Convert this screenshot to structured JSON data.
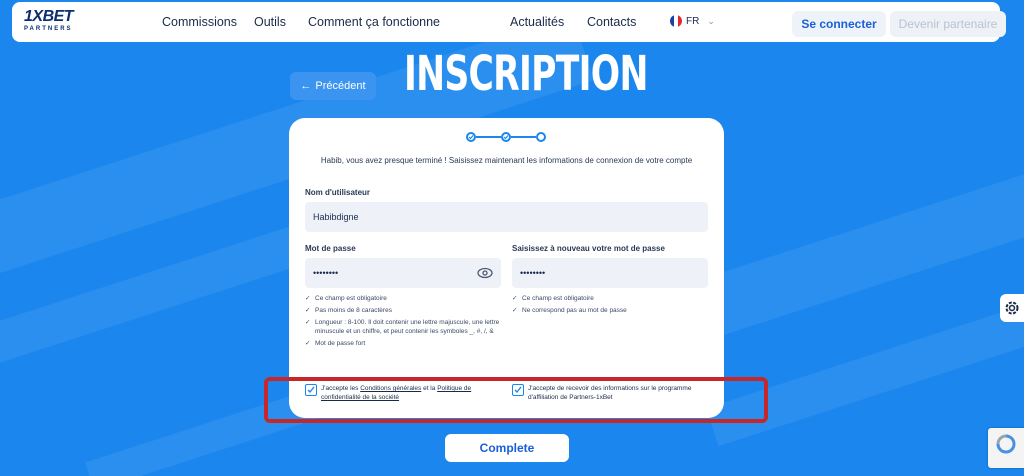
{
  "logo": {
    "brand": "1XBET",
    "sub": "PARTNERS"
  },
  "nav": [
    {
      "label": "Commissions"
    },
    {
      "label": "Outils"
    },
    {
      "label": "Comment ça fonctionne"
    },
    {
      "label": "Actualités"
    },
    {
      "label": "Contacts"
    }
  ],
  "language": {
    "code": "FR",
    "icon": "france-flag-icon"
  },
  "header_buttons": {
    "login": "Se connecter",
    "partner": "Devenir partenaire"
  },
  "page": {
    "title": "INSCRIPTION",
    "back_label": "Précédent"
  },
  "form": {
    "steps_total": 3,
    "steps_completed": 2,
    "intro": "Habib, vous avez presque terminé ! Saisissez maintenant les informations de connexion de votre compte",
    "username_label": "Nom d'utilisateur",
    "username_value": "Habibdigne",
    "password_label": "Mot de passe",
    "password_value": "••••••••",
    "confirm_label": "Saisissez à nouveau votre mot de passe",
    "confirm_value": "••••••••",
    "password_hints": [
      "Ce champ est obligatoire",
      "Pas moins de 8 caractères",
      "Longueur : 8-100. Il doit contenir une lettre majuscule, une lettre minuscule et un chiffre, et peut contenir les symboles _, #, /, &",
      "Mot de passe fort"
    ],
    "confirm_hints": [
      "Ce champ est obligatoire",
      "Ne correspond pas au mot de passe"
    ],
    "consent_terms": {
      "prefix": "J'accepte les",
      "link1": "Conditions générales",
      "middle": "et la",
      "link2": "Politique de confidentialité de la société",
      "checked": true
    },
    "consent_newsletter": {
      "text": "J'accepte de recevoir des informations sur le programme d'affiliation de Partners-1xBet",
      "checked": true
    },
    "submit_label": "Complete"
  },
  "colors": {
    "background": "#1a86ee",
    "accent": "#1a5fd6",
    "highlight_border": "#c6282a"
  }
}
